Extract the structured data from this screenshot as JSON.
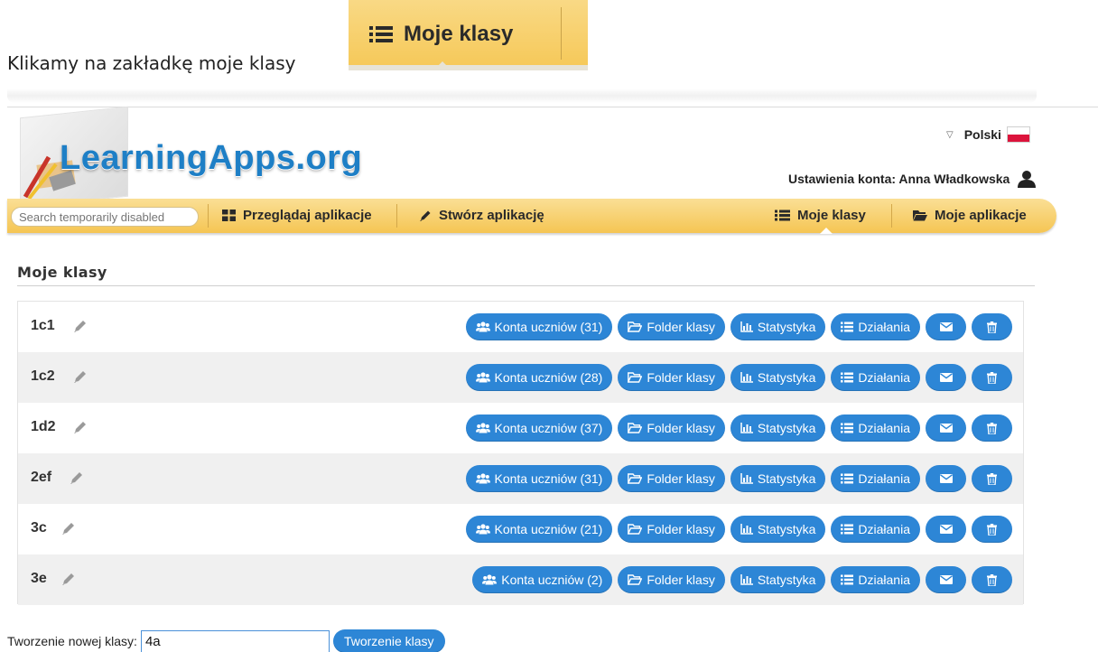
{
  "intro": {
    "text": "Klikamy na zakładkę moje klasy"
  },
  "crop_tab": {
    "label": "Moje klasy",
    "icon": "list-icon"
  },
  "header": {
    "logo": "LearningApps.org",
    "language": "Polski",
    "account": "Ustawienia konta: Anna Władkowska"
  },
  "nav": {
    "search_placeholder": "Search temporarily disabled",
    "items": [
      {
        "label": "Przeglądaj aplikacje",
        "icon": "grid-icon"
      },
      {
        "label": "Stwórz aplikację",
        "icon": "pencil-icon"
      },
      {
        "label": "Moje klasy",
        "icon": "list-icon"
      },
      {
        "label": "Moje aplikacje",
        "icon": "folder-icon"
      }
    ]
  },
  "section": {
    "title": "Moje klasy"
  },
  "labels": {
    "folder": "Folder klasy",
    "stats": "Statystyka",
    "actions": "Działania"
  },
  "classes": [
    {
      "name": "1c1",
      "students": "Konta uczniów (31)"
    },
    {
      "name": "1c2",
      "students": "Konta uczniów (28)"
    },
    {
      "name": "1d2",
      "students": "Konta uczniów (37)"
    },
    {
      "name": "2ef",
      "students": "Konta uczniów (31)"
    },
    {
      "name": "3c",
      "students": "Konta uczniów (21)"
    },
    {
      "name": "3e",
      "students": "Konta uczniów (2)"
    }
  ],
  "create": {
    "label": "Tworzenie nowej klasy:",
    "value": "4a",
    "button": "Tworzenie klasy"
  },
  "colors": {
    "accent": "#2d86d6",
    "navbar": "#f5c553",
    "logo": "#1e7fc6"
  }
}
